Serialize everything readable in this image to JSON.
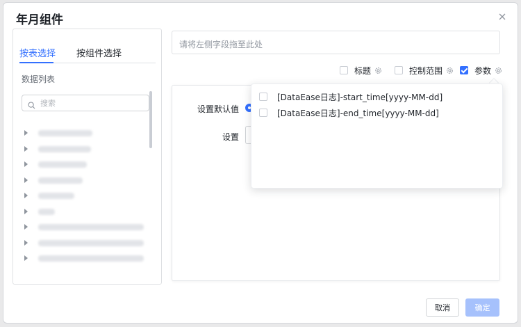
{
  "dialog": {
    "title": "年月组件"
  },
  "left": {
    "tabs": [
      {
        "label": "按表选择",
        "active": true
      },
      {
        "label": "按组件选择",
        "active": false
      }
    ],
    "list_label": "数据列表",
    "search_placeholder": "搜索",
    "tree_items_count": 9
  },
  "right": {
    "drop_zone_placeholder": "请将左侧字段拖至此处",
    "options": [
      {
        "label": "标题",
        "checked": false
      },
      {
        "label": "控制范围",
        "checked": false
      },
      {
        "label": "参数",
        "checked": true
      }
    ],
    "default_value_label": "设置默认值",
    "set_label": "设置"
  },
  "popover": {
    "items": [
      {
        "label": "[DataEase日志]-start_time[yyyy-MM-dd]",
        "checked": false
      },
      {
        "label": "[DataEase日志]-end_time[yyyy-MM-dd]",
        "checked": false
      }
    ]
  },
  "footer": {
    "cancel_label": "取消",
    "ok_label": "确定"
  },
  "colors": {
    "accent": "#3370ff",
    "ok_disabled": "#a6c1fc"
  }
}
